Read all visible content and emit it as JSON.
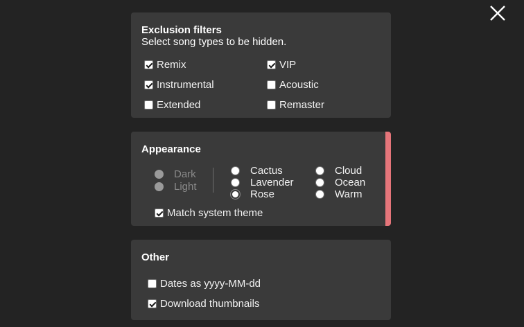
{
  "close_icon_label": "close",
  "exclusion": {
    "title": "Exclusion filters",
    "subtitle": "Select song types to be hidden.",
    "options": [
      {
        "label": "Remix",
        "checked": true
      },
      {
        "label": "VIP",
        "checked": true
      },
      {
        "label": "Instrumental",
        "checked": true
      },
      {
        "label": "Acoustic",
        "checked": false
      },
      {
        "label": "Extended",
        "checked": false
      },
      {
        "label": "Remaster",
        "checked": false
      }
    ]
  },
  "appearance": {
    "title": "Appearance",
    "modes": [
      {
        "label": "Dark",
        "disabled": true
      },
      {
        "label": "Light",
        "disabled": true
      }
    ],
    "themes": [
      {
        "label": "Cactus"
      },
      {
        "label": "Lavender"
      },
      {
        "label": "Rose",
        "selected": true
      },
      {
        "label": "Cloud"
      },
      {
        "label": "Ocean"
      },
      {
        "label": "Warm"
      }
    ],
    "match_system": {
      "label": "Match system theme",
      "checked": true
    },
    "accent_color": "#e5757a"
  },
  "other": {
    "title": "Other",
    "options": [
      {
        "label": "Dates as yyyy-MM-dd",
        "checked": false
      },
      {
        "label": "Download thumbnails",
        "checked": true
      }
    ]
  }
}
